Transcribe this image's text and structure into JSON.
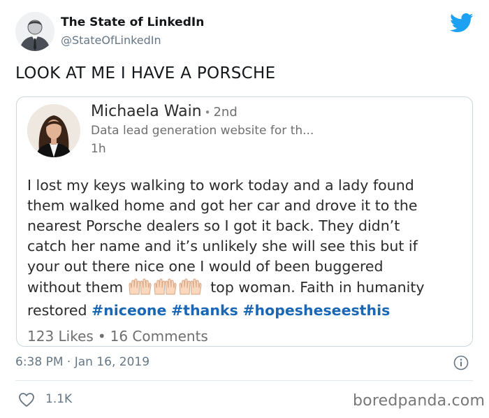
{
  "tweet": {
    "author_name": "The State of LinkedIn",
    "author_handle": "@StateOfLinkedIn",
    "text": "LOOK AT ME I HAVE A PORSCHE",
    "timestamp": "6:38 PM · Jan 16, 2019",
    "likes": "1.1K",
    "brand_color": "#1da1f2"
  },
  "linkedin_post": {
    "name": "Michaela Wain",
    "separator": "•",
    "degree": "2nd",
    "headline": "Data lead generation website for th...",
    "time": "1h",
    "body_lines": [
      "I lost my keys walking to work today and a lady found",
      "them walked home and got her car and drove it to the",
      "nearest Porsche dealers so I got it back. They didn’t",
      "catch her name and it’s unlikely she will see this but if",
      "your out there nice one I would of been buggered"
    ],
    "line6_prefix": "without them",
    "line6_suffix": "top woman. Faith in humanity",
    "line7_prefix": "restored",
    "hashtags": [
      "#niceone",
      "#thanks",
      "#hopesheseesthis"
    ],
    "likes": "123 Likes",
    "stat_separator": "•",
    "comments": "16 Comments",
    "hashtag_color": "#1a67b5"
  },
  "icons": {
    "bird": "twitter-bird-icon",
    "info": "info-icon",
    "heart": "heart-icon",
    "emoji": "raising-hands-emoji"
  },
  "watermark": "boredpanda.com"
}
